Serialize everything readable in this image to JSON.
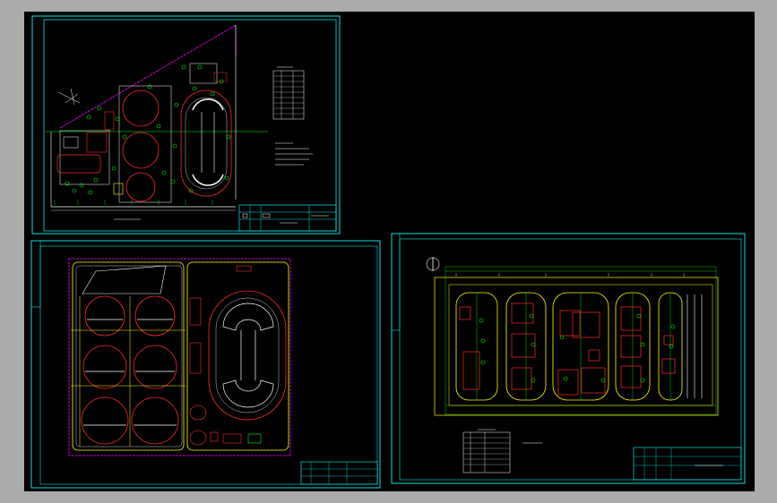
{
  "app": {
    "background_color": "#ababab",
    "canvas_color": "#000000"
  },
  "colors": {
    "frame": "#00e5e5",
    "outline": "#ffff00",
    "detail": "#ff2a2a",
    "vegetation": "#00ff00",
    "road": "#ff00ff",
    "text": "#ffffff"
  },
  "sheets": [
    {
      "id": "site-plan",
      "title_block": true,
      "table": true,
      "north_arrow": true
    },
    {
      "id": "tank-layout",
      "title_block": true,
      "circles": 6
    },
    {
      "id": "field-layout",
      "title_block": true,
      "table": true,
      "north_arrow": true
    }
  ]
}
